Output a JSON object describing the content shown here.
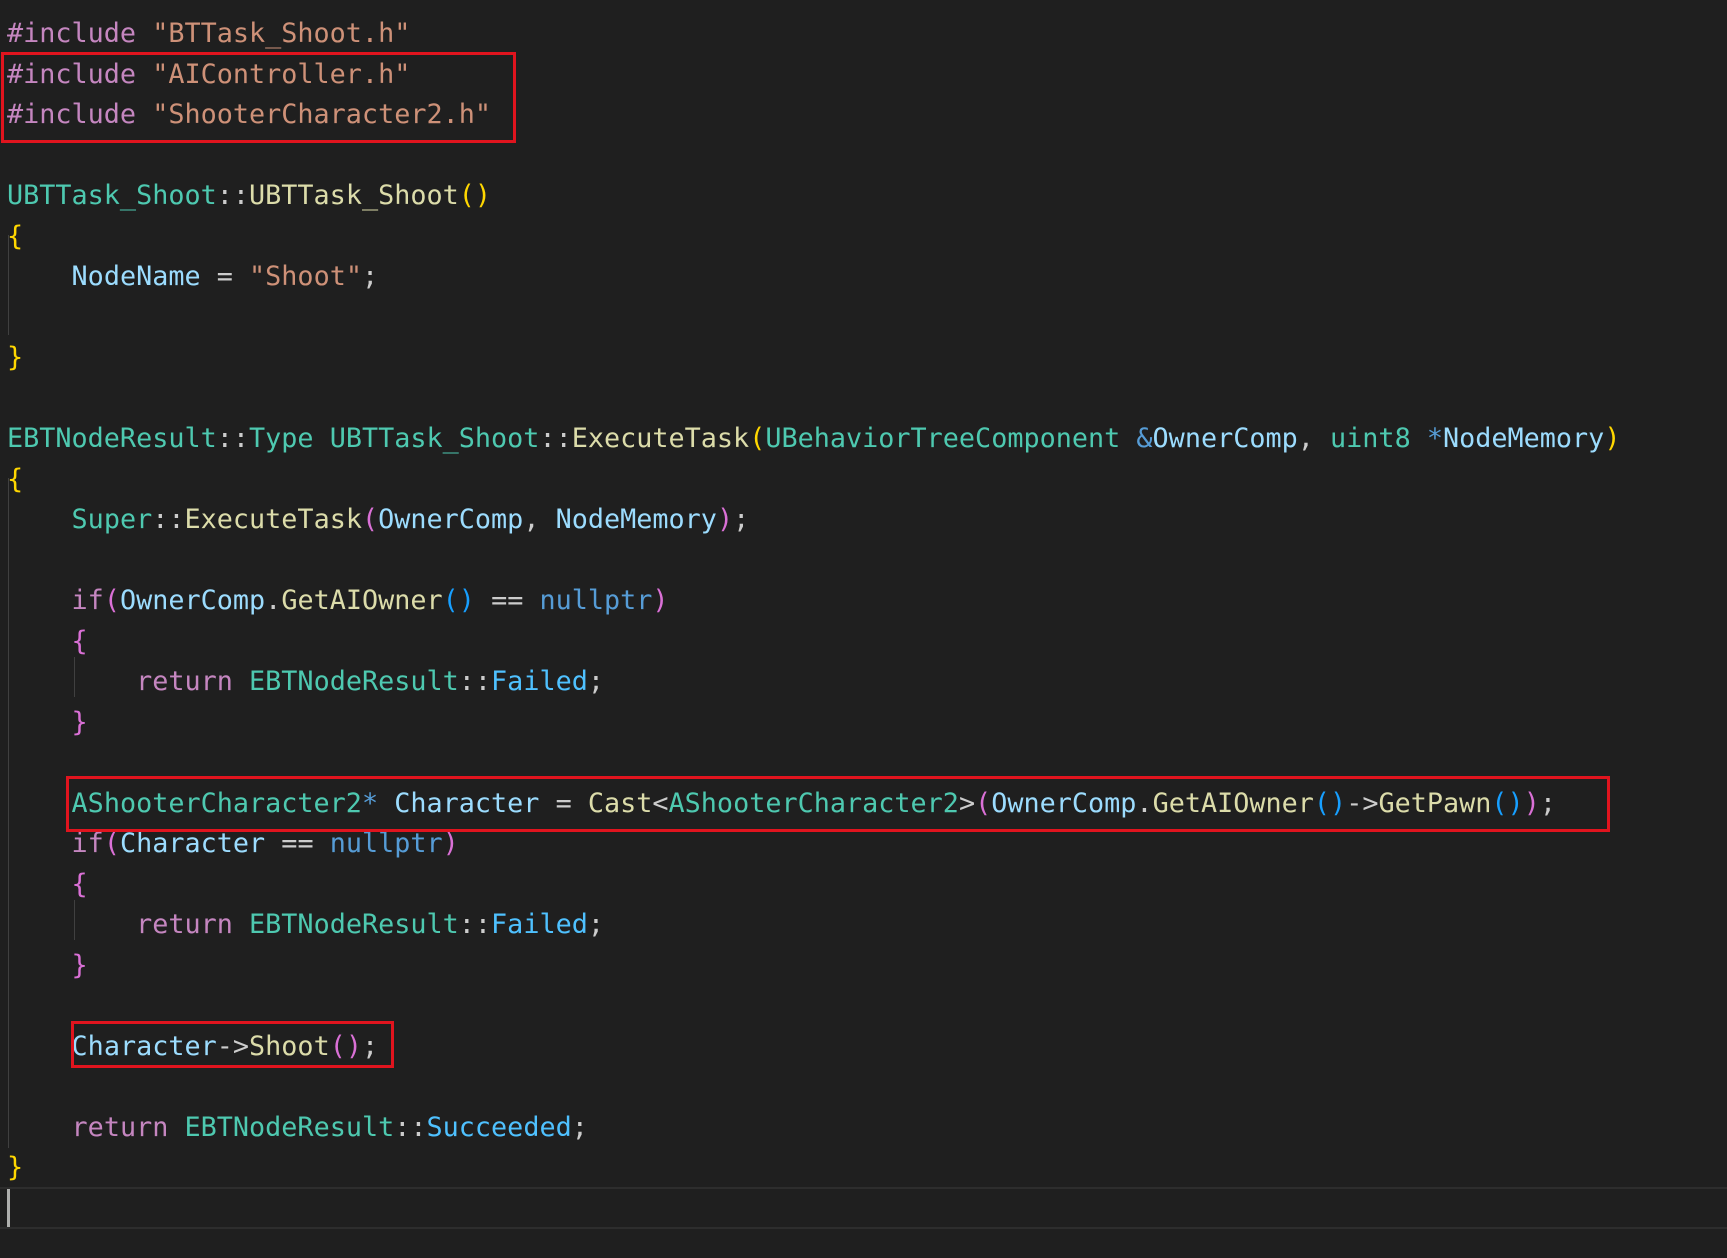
{
  "colors": {
    "background": "#1f1f1f",
    "default": "#cccccc",
    "preprocessor": "#c586c0",
    "string": "#ce9178",
    "type": "#4ec9b0",
    "function": "#dcdcaa",
    "variable": "#9cdcfe",
    "keyword_blue": "#569cd6",
    "control": "#c586c0",
    "enum_member": "#4fc1ff",
    "bracket_gold": "#ffd700",
    "bracket_pink": "#da70d6",
    "bracket_blue": "#179fff",
    "highlight_box": "#e0141e"
  },
  "code": {
    "lines": [
      [
        {
          "t": "#include ",
          "c": "preprocessor"
        },
        {
          "t": "\"BTTask_Shoot.h\"",
          "c": "string"
        }
      ],
      [
        {
          "t": "#include ",
          "c": "preprocessor"
        },
        {
          "t": "\"AIController.h\"",
          "c": "string"
        }
      ],
      [
        {
          "t": "#include ",
          "c": "preprocessor"
        },
        {
          "t": "\"ShooterCharacter2.h\"",
          "c": "string"
        }
      ],
      [],
      [
        {
          "t": "UBTTask_Shoot",
          "c": "type"
        },
        {
          "t": "::",
          "c": "default"
        },
        {
          "t": "UBTTask_Shoot",
          "c": "function"
        },
        {
          "t": "()",
          "c": "bracket_gold"
        }
      ],
      [
        {
          "t": "{",
          "c": "bracket_gold"
        }
      ],
      [
        {
          "t": "    ",
          "c": "default"
        },
        {
          "t": "NodeName",
          "c": "variable"
        },
        {
          "t": " = ",
          "c": "default"
        },
        {
          "t": "\"Shoot\"",
          "c": "string"
        },
        {
          "t": ";",
          "c": "default"
        }
      ],
      [],
      [
        {
          "t": "}",
          "c": "bracket_gold"
        }
      ],
      [],
      [
        {
          "t": "EBTNodeResult",
          "c": "type"
        },
        {
          "t": "::",
          "c": "default"
        },
        {
          "t": "Type",
          "c": "type"
        },
        {
          "t": " ",
          "c": "default"
        },
        {
          "t": "UBTTask_Shoot",
          "c": "type"
        },
        {
          "t": "::",
          "c": "default"
        },
        {
          "t": "ExecuteTask",
          "c": "function"
        },
        {
          "t": "(",
          "c": "bracket_gold"
        },
        {
          "t": "UBehaviorTreeComponent",
          "c": "type"
        },
        {
          "t": " ",
          "c": "default"
        },
        {
          "t": "&",
          "c": "keyword_blue"
        },
        {
          "t": "OwnerComp",
          "c": "variable"
        },
        {
          "t": ", ",
          "c": "default"
        },
        {
          "t": "uint8",
          "c": "type"
        },
        {
          "t": " ",
          "c": "default"
        },
        {
          "t": "*",
          "c": "keyword_blue"
        },
        {
          "t": "NodeMemory",
          "c": "variable"
        },
        {
          "t": ")",
          "c": "bracket_gold"
        }
      ],
      [
        {
          "t": "{",
          "c": "bracket_gold"
        }
      ],
      [
        {
          "t": "    ",
          "c": "default"
        },
        {
          "t": "Super",
          "c": "type"
        },
        {
          "t": "::",
          "c": "default"
        },
        {
          "t": "ExecuteTask",
          "c": "function"
        },
        {
          "t": "(",
          "c": "bracket_pink"
        },
        {
          "t": "OwnerComp",
          "c": "variable"
        },
        {
          "t": ", ",
          "c": "default"
        },
        {
          "t": "NodeMemory",
          "c": "variable"
        },
        {
          "t": ")",
          "c": "bracket_pink"
        },
        {
          "t": ";",
          "c": "default"
        }
      ],
      [],
      [
        {
          "t": "    ",
          "c": "default"
        },
        {
          "t": "if",
          "c": "control"
        },
        {
          "t": "(",
          "c": "bracket_pink"
        },
        {
          "t": "OwnerComp",
          "c": "variable"
        },
        {
          "t": ".",
          "c": "default"
        },
        {
          "t": "GetAIOwner",
          "c": "function"
        },
        {
          "t": "()",
          "c": "bracket_blue"
        },
        {
          "t": " == ",
          "c": "default"
        },
        {
          "t": "nullptr",
          "c": "keyword_blue"
        },
        {
          "t": ")",
          "c": "bracket_pink"
        }
      ],
      [
        {
          "t": "    ",
          "c": "default"
        },
        {
          "t": "{",
          "c": "bracket_pink"
        }
      ],
      [
        {
          "t": "        ",
          "c": "default"
        },
        {
          "t": "return",
          "c": "control"
        },
        {
          "t": " ",
          "c": "default"
        },
        {
          "t": "EBTNodeResult",
          "c": "type"
        },
        {
          "t": "::",
          "c": "default"
        },
        {
          "t": "Failed",
          "c": "enum_member"
        },
        {
          "t": ";",
          "c": "default"
        }
      ],
      [
        {
          "t": "    ",
          "c": "default"
        },
        {
          "t": "}",
          "c": "bracket_pink"
        }
      ],
      [],
      [
        {
          "t": "    ",
          "c": "default"
        },
        {
          "t": "AShooterCharacter2",
          "c": "type"
        },
        {
          "t": "*",
          "c": "keyword_blue"
        },
        {
          "t": " ",
          "c": "default"
        },
        {
          "t": "Character",
          "c": "variable"
        },
        {
          "t": " = ",
          "c": "default"
        },
        {
          "t": "Cast",
          "c": "function"
        },
        {
          "t": "<",
          "c": "default"
        },
        {
          "t": "AShooterCharacter2",
          "c": "type"
        },
        {
          "t": ">",
          "c": "default"
        },
        {
          "t": "(",
          "c": "bracket_pink"
        },
        {
          "t": "OwnerComp",
          "c": "variable"
        },
        {
          "t": ".",
          "c": "default"
        },
        {
          "t": "GetAIOwner",
          "c": "function"
        },
        {
          "t": "()",
          "c": "bracket_blue"
        },
        {
          "t": "->",
          "c": "default"
        },
        {
          "t": "GetPawn",
          "c": "function"
        },
        {
          "t": "()",
          "c": "bracket_blue"
        },
        {
          "t": ")",
          "c": "bracket_pink"
        },
        {
          "t": ";",
          "c": "default"
        }
      ],
      [
        {
          "t": "    ",
          "c": "default"
        },
        {
          "t": "if",
          "c": "control"
        },
        {
          "t": "(",
          "c": "bracket_pink"
        },
        {
          "t": "Character",
          "c": "variable"
        },
        {
          "t": " == ",
          "c": "default"
        },
        {
          "t": "nullptr",
          "c": "keyword_blue"
        },
        {
          "t": ")",
          "c": "bracket_pink"
        }
      ],
      [
        {
          "t": "    ",
          "c": "default"
        },
        {
          "t": "{",
          "c": "bracket_pink"
        }
      ],
      [
        {
          "t": "        ",
          "c": "default"
        },
        {
          "t": "return",
          "c": "control"
        },
        {
          "t": " ",
          "c": "default"
        },
        {
          "t": "EBTNodeResult",
          "c": "type"
        },
        {
          "t": "::",
          "c": "default"
        },
        {
          "t": "Failed",
          "c": "enum_member"
        },
        {
          "t": ";",
          "c": "default"
        }
      ],
      [
        {
          "t": "    ",
          "c": "default"
        },
        {
          "t": "}",
          "c": "bracket_pink"
        }
      ],
      [],
      [
        {
          "t": "    ",
          "c": "default"
        },
        {
          "t": "Character",
          "c": "variable"
        },
        {
          "t": "->",
          "c": "default"
        },
        {
          "t": "Shoot",
          "c": "function"
        },
        {
          "t": "()",
          "c": "bracket_pink"
        },
        {
          "t": ";",
          "c": "default"
        }
      ],
      [],
      [
        {
          "t": "    ",
          "c": "default"
        },
        {
          "t": "return",
          "c": "control"
        },
        {
          "t": " ",
          "c": "default"
        },
        {
          "t": "EBTNodeResult",
          "c": "type"
        },
        {
          "t": "::",
          "c": "default"
        },
        {
          "t": "Succeeded",
          "c": "enum_member"
        },
        {
          "t": ";",
          "c": "default"
        }
      ],
      [
        {
          "t": "}",
          "c": "bracket_gold"
        }
      ],
      []
    ]
  }
}
